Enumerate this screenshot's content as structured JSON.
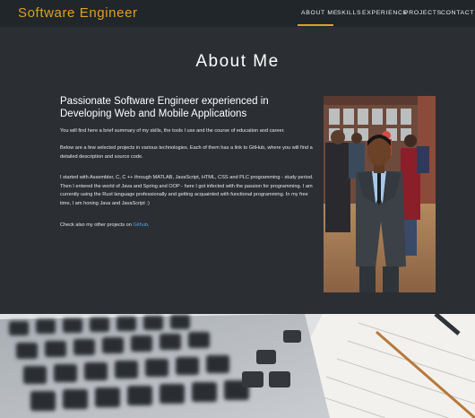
{
  "navbar": {
    "brand": "Software Engineer",
    "items": [
      {
        "label": "ABOUT ME",
        "active": true
      },
      {
        "label": "SKILLS",
        "active": false
      },
      {
        "label": "EXPERIENCE",
        "active": false
      },
      {
        "label": "PROJECTS",
        "active": false
      },
      {
        "label": "CONTACT",
        "active": false
      }
    ]
  },
  "about": {
    "title": "About Me",
    "heading": "Passionate Software Engineer experienced in Developing Web and Mobile Applications",
    "paragraphs": [
      "You will find here a brief summary of my skills, the tools I use and the course of education and career.",
      "Below are a few selected projects in various technologies. Each of them has a link to GitHub, where you will find a detailed description and source code.",
      "I started with Assembler, C, C ++ through MATLAB, JavaScript, HTML, CSS and PLC programming - study period. Then I entered the world of Java and Spring and OOP - here I got infected with the passion for programming. I am currently using the Rust language professionally and getting acquainted with functional programming. In my free time, I am honing Java and JavaScript :)"
    ],
    "github_prefix": "Check also my other projects on ",
    "github_link": "Github",
    "github_suffix": "."
  },
  "colors": {
    "accent": "#e0a020",
    "background": "#2b2f34",
    "navbar": "#21262a",
    "link": "#4aa8e0"
  }
}
